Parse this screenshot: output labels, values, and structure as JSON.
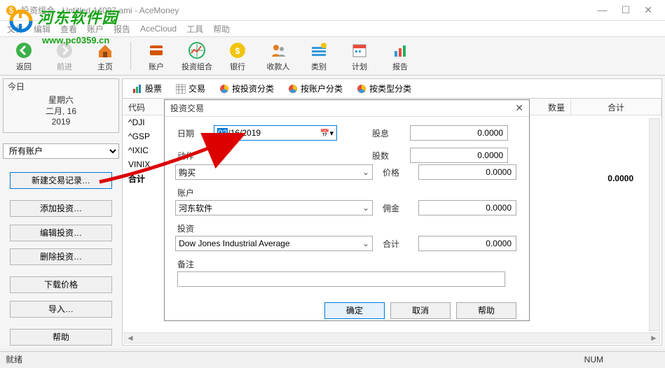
{
  "window": {
    "title": "投资组合 - Untitled 14097.ami - AceMoney"
  },
  "watermark": {
    "site_name": "河东软件园",
    "url": "www.pc0359.cn"
  },
  "menubar": [
    "文件",
    "编辑",
    "查看",
    "账户",
    "报告",
    "AceCloud",
    "工具",
    "帮助"
  ],
  "toolbar": [
    {
      "label": "返回",
      "icon": "back",
      "enabled": true
    },
    {
      "label": "前进",
      "icon": "forward",
      "enabled": false
    },
    {
      "label": "主页",
      "icon": "home",
      "enabled": true
    },
    {
      "label": "账户",
      "icon": "accounts",
      "enabled": true
    },
    {
      "label": "投资组合",
      "icon": "portfolio",
      "enabled": true
    },
    {
      "label": "银行",
      "icon": "bank",
      "enabled": true
    },
    {
      "label": "收款人",
      "icon": "payee",
      "enabled": true
    },
    {
      "label": "类别",
      "icon": "category",
      "enabled": true
    },
    {
      "label": "计划",
      "icon": "plan",
      "enabled": true
    },
    {
      "label": "报告",
      "icon": "report",
      "enabled": true
    }
  ],
  "today": {
    "title": "今日",
    "weekday": "星期六",
    "date": "二月, 16",
    "year": "2019"
  },
  "account_selector": "所有账户",
  "side_buttons": [
    "新建交易记录…",
    "添加投资…",
    "编辑投资…",
    "删除投资…",
    "下载价格",
    "导入…",
    "帮助"
  ],
  "tabs": [
    {
      "label": "股票",
      "icon": "bars"
    },
    {
      "label": "交易",
      "icon": "grid"
    },
    {
      "label": "按投资分类",
      "icon": "pie"
    },
    {
      "label": "按账户分类",
      "icon": "pie"
    },
    {
      "label": "按类型分类",
      "icon": "pie"
    }
  ],
  "grid": {
    "headers": {
      "code": "代码",
      "qty": "数量",
      "total": "合计"
    },
    "rows": [
      "^DJI",
      "^GSP",
      "^IXIC",
      "VINIX"
    ],
    "footer_label": "合计",
    "footer_value": "0.0000"
  },
  "dialog": {
    "title": "投资交易",
    "labels": {
      "date": "日期",
      "action": "动作",
      "account": "账户",
      "investment": "投资",
      "note": "备注",
      "dividend": "股息",
      "shares": "股数",
      "price": "价格",
      "commission": "佣金",
      "total": "合计"
    },
    "date_sel": "02",
    "date_rest": "/16/2019",
    "action_value": "购买",
    "account_value": "河东软件",
    "investment_value": "Dow Jones Industrial Average",
    "values": {
      "dividend": "0.0000",
      "shares": "0.0000",
      "price": "0.0000",
      "commission": "0.0000",
      "total": "0.0000"
    },
    "buttons": {
      "ok": "确定",
      "cancel": "取消",
      "help": "帮助"
    }
  },
  "statusbar": {
    "left": "就绪",
    "right": "NUM"
  }
}
